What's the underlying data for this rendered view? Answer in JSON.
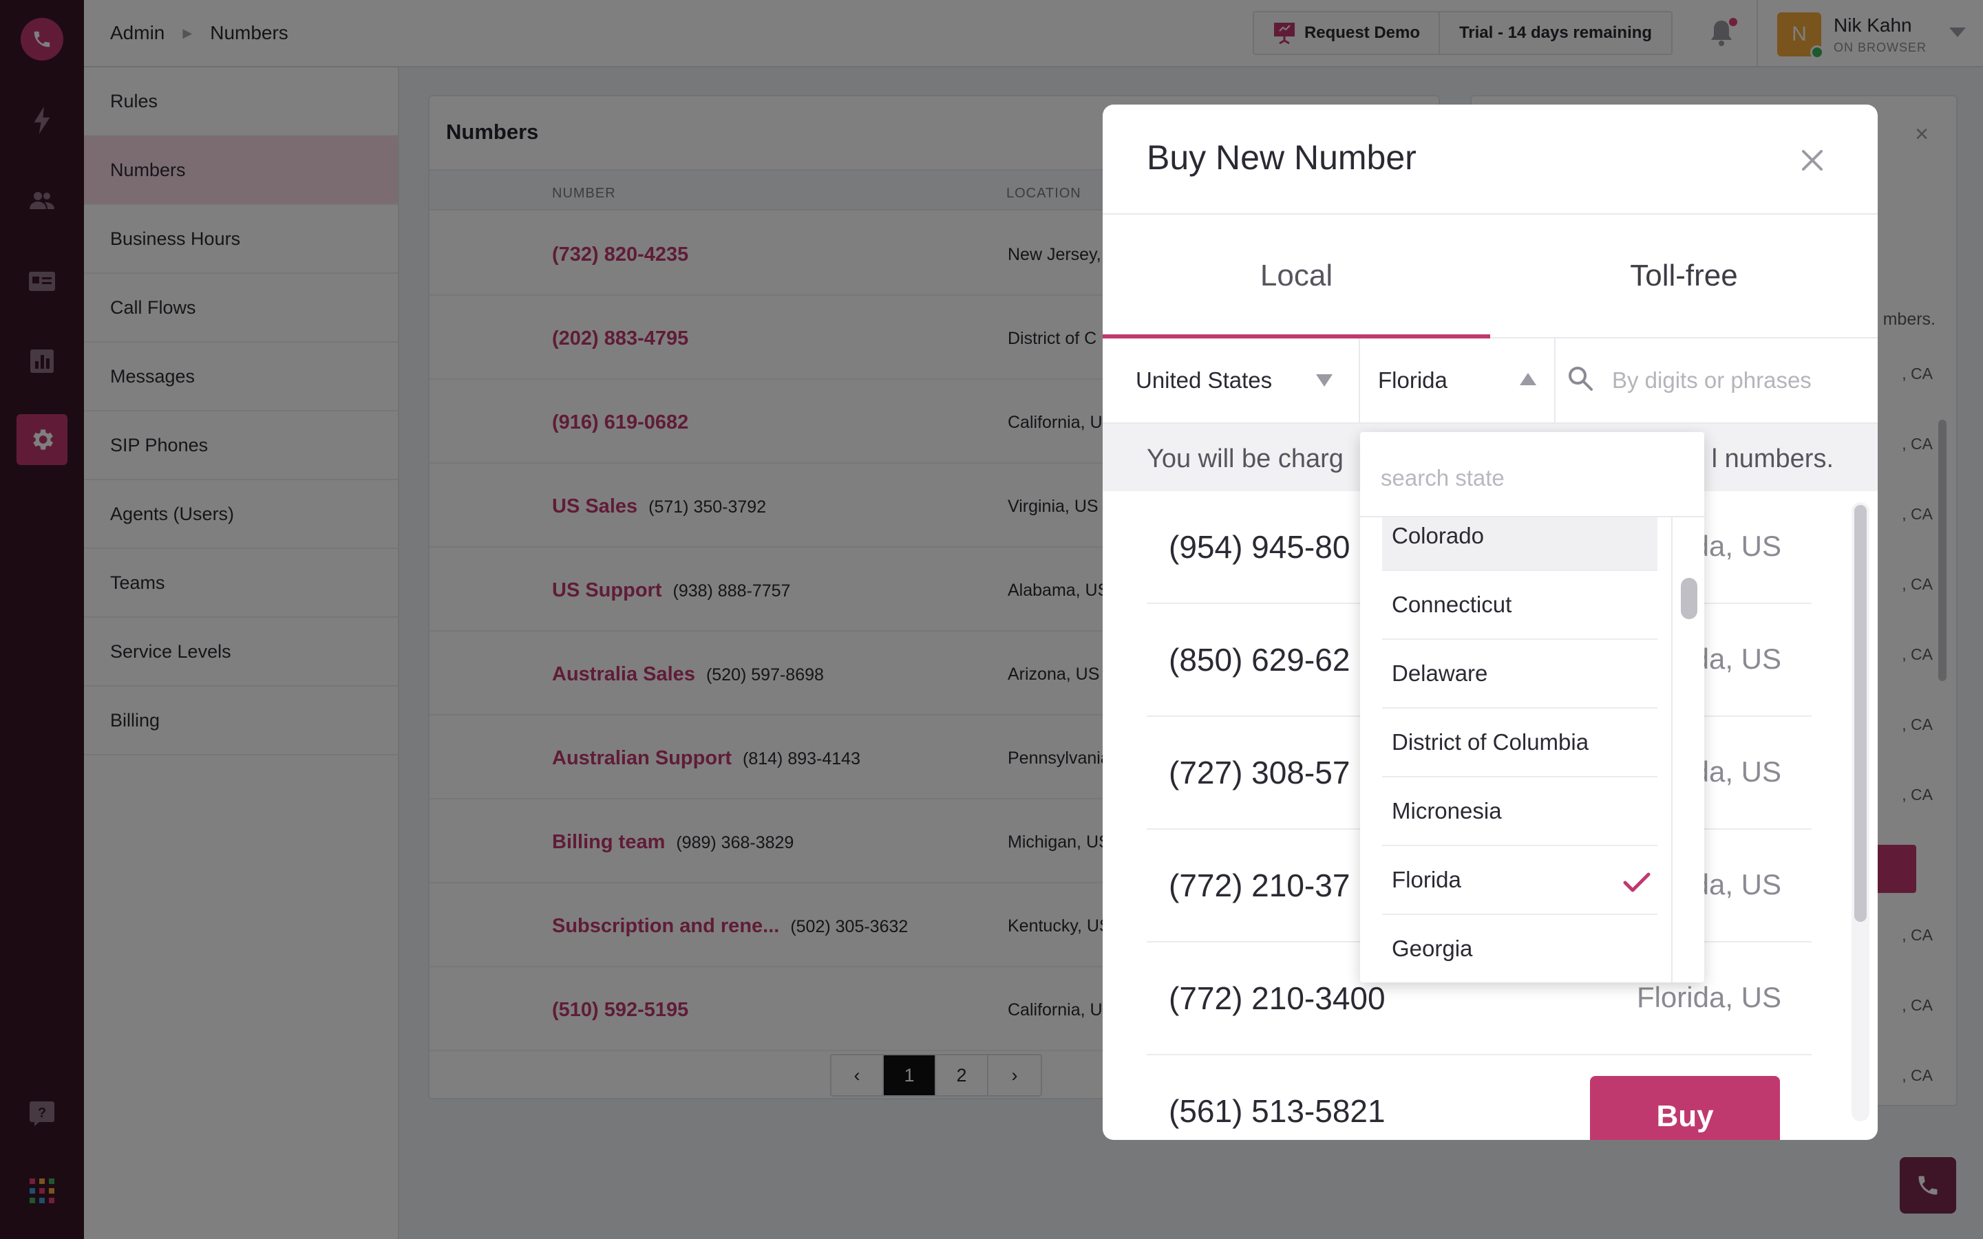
{
  "header": {
    "breadcrumb_root": "Admin",
    "breadcrumb_current": "Numbers",
    "request_demo": "Request Demo",
    "trial": "Trial - 14 days remaining",
    "user_initial": "N",
    "user_name": "Nik Kahn",
    "user_status": "ON BROWSER"
  },
  "subnav": {
    "items": [
      "Rules",
      "Numbers",
      "Business Hours",
      "Call Flows",
      "Messages",
      "SIP Phones",
      "Agents (Users)",
      "Teams",
      "Service Levels",
      "Billing"
    ],
    "active": "Numbers"
  },
  "numbers_card": {
    "title": "Numbers",
    "col_number": "NUMBER",
    "col_location": "LOCATION",
    "rows": [
      {
        "name": "(732) 820-4235",
        "number": "",
        "location": "New Jersey,"
      },
      {
        "name": "(202) 883-4795",
        "number": "",
        "location": "District of C"
      },
      {
        "name": "(916) 619-0682",
        "number": "",
        "location": "California, U"
      },
      {
        "name": "US Sales",
        "number": "(571) 350-3792",
        "location": "Virginia, US"
      },
      {
        "name": "US Support",
        "number": "(938) 888-7757",
        "location": "Alabama, US"
      },
      {
        "name": "Australia Sales",
        "number": "(520) 597-8698",
        "location": "Arizona, US"
      },
      {
        "name": "Australian Support",
        "number": "(814) 893-4143",
        "location": "Pennsylvania"
      },
      {
        "name": "Billing team",
        "number": "(989) 368-3829",
        "location": "Michigan, US"
      },
      {
        "name": "Subscription and rene...",
        "number": "(502) 305-3632",
        "location": "Kentucky, US"
      },
      {
        "name": "(510) 592-5195",
        "number": "",
        "location": "California, U"
      }
    ],
    "pager": {
      "prev": "‹",
      "page1": "1",
      "page2": "2",
      "next": "›"
    }
  },
  "detail_panel": {
    "close": "×",
    "note": "mbers.",
    "mini": [
      ", CA",
      ", CA",
      ", CA",
      ", CA",
      ", CA",
      ", CA",
      ", CA",
      ", CA",
      ", CA",
      ", CA"
    ]
  },
  "modal": {
    "title": "Buy New Number",
    "tab_local": "Local",
    "tab_tollfree": "Toll-free",
    "country": "United States",
    "state": "Florida",
    "search_placeholder": "By digits or phrases",
    "charge_left": "You will be charg",
    "charge_right": "l numbers.",
    "results": [
      {
        "number": "(954) 945-80",
        "location": "rida, US"
      },
      {
        "number": "(850) 629-62",
        "location": "rida, US"
      },
      {
        "number": "(727) 308-57",
        "location": "rida, US"
      },
      {
        "number": "(772) 210-37",
        "location": "rida, US"
      },
      {
        "number": "(772) 210-3400",
        "location": "Florida, US"
      },
      {
        "number": "(561) 513-5821",
        "location": ""
      }
    ],
    "buy_label": "Buy"
  },
  "state_dropdown": {
    "search_placeholder": "search state",
    "items": [
      "Colorado",
      "Connecticut",
      "Delaware",
      "District of Columbia",
      "Micronesia",
      "Florida",
      "Georgia"
    ],
    "selected": "Florida"
  },
  "colors": {
    "brand": "#c0396e",
    "rail": "#3b1628",
    "active_nav": "#f7d9e5"
  }
}
